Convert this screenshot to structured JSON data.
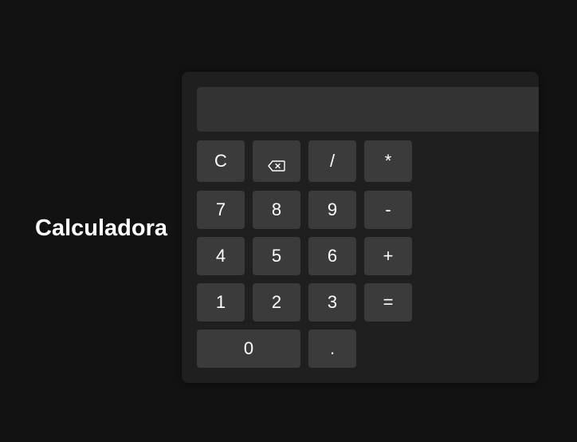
{
  "title": "Calculadora",
  "display": {
    "value": ""
  },
  "keys": {
    "clear": "C",
    "backspace_icon": "backspace-icon",
    "divide": "/",
    "multiply": "*",
    "seven": "7",
    "eight": "8",
    "nine": "9",
    "minus": "-",
    "four": "4",
    "five": "5",
    "six": "6",
    "plus": "+",
    "one": "1",
    "two": "2",
    "three": "3",
    "equals": "=",
    "zero": "0",
    "dot": "."
  },
  "colors": {
    "background": "#121212",
    "panel": "#1f1f1f",
    "display": "#333333",
    "key": "#3b3b3b",
    "text": "#ffffff"
  }
}
